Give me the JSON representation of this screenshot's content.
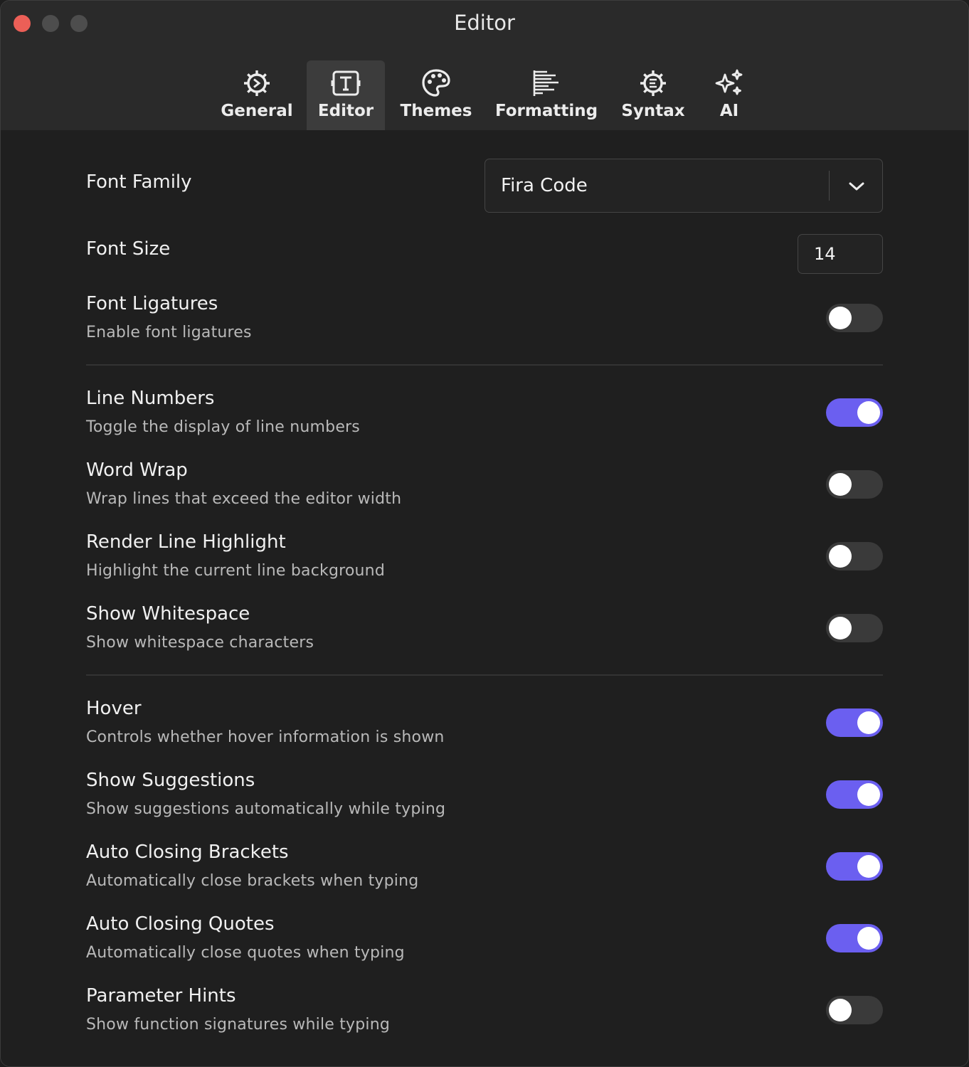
{
  "window": {
    "title": "Editor",
    "traffic_colors": {
      "close": "#ec5f57",
      "minimize": "#4d4d4d",
      "zoom": "#4d4d4d"
    }
  },
  "tabs": [
    {
      "label": "General",
      "icon": "gear-icon",
      "active": false
    },
    {
      "label": "Editor",
      "icon": "text-cursor-icon",
      "active": true
    },
    {
      "label": "Themes",
      "icon": "palette-icon",
      "active": false
    },
    {
      "label": "Formatting",
      "icon": "align-left-icon",
      "active": false
    },
    {
      "label": "Syntax",
      "icon": "code-gear-icon",
      "active": false
    },
    {
      "label": "AI",
      "icon": "sparkles-icon",
      "active": false
    }
  ],
  "font_family": {
    "label": "Font Family",
    "value": "Fira Code"
  },
  "font_size": {
    "label": "Font Size",
    "value": "14"
  },
  "settings": [
    {
      "title": "Font Ligatures",
      "desc": "Enable font ligatures",
      "on": false
    },
    {
      "title": "Line Numbers",
      "desc": "Toggle the display of line numbers",
      "on": true
    },
    {
      "title": "Word Wrap",
      "desc": "Wrap lines that exceed the editor width",
      "on": false
    },
    {
      "title": "Render Line Highlight",
      "desc": "Highlight the current line background",
      "on": false
    },
    {
      "title": "Show Whitespace",
      "desc": "Show whitespace characters",
      "on": false
    },
    {
      "title": "Hover",
      "desc": "Controls whether hover information is shown",
      "on": true
    },
    {
      "title": "Show Suggestions",
      "desc": "Show suggestions automatically while typing",
      "on": true
    },
    {
      "title": "Auto Closing Brackets",
      "desc": "Automatically close brackets when typing",
      "on": true
    },
    {
      "title": "Auto Closing Quotes",
      "desc": "Automatically close quotes when typing",
      "on": true
    },
    {
      "title": "Parameter Hints",
      "desc": "Show function signatures while typing",
      "on": false
    }
  ],
  "colors": {
    "accent": "#6b5ff0",
    "toggle_off": "#3a3a3a"
  }
}
